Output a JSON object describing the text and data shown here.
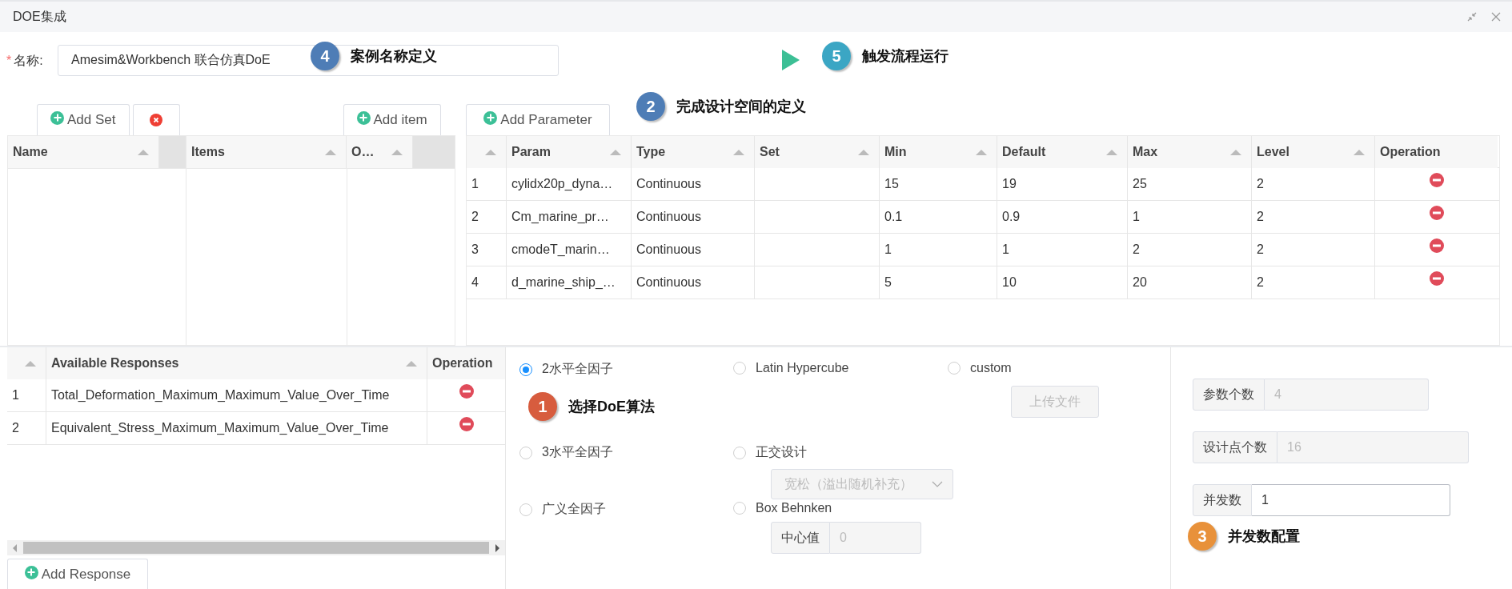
{
  "window": {
    "title": "DOE集成"
  },
  "name_field": {
    "label": "名称:",
    "required_mark": "*",
    "value": "Amesim&Workbench 联合仿真DoE"
  },
  "callouts": [
    {
      "number": "4",
      "text": "案例名称定义",
      "color": "#4e7db6"
    },
    {
      "number": "5",
      "text": "触发流程运行",
      "color": "#3ba6c4"
    },
    {
      "number": "2",
      "text": "完成设计空间的定义",
      "color": "#4e7db6"
    },
    {
      "number": "1",
      "text": "选择DoE算法",
      "color": "#d75c3e"
    },
    {
      "number": "3",
      "text": "并发数配置",
      "color": "#e8913a"
    }
  ],
  "sets_toolbar": {
    "add_set": "Add Set",
    "add_item": "Add item"
  },
  "sets_table": {
    "columns": [
      "Name"
    ]
  },
  "items_table": {
    "columns": [
      "Items",
      "O…"
    ]
  },
  "params_toolbar": {
    "add_parameter": "Add Parameter"
  },
  "params_table": {
    "columns": [
      "Param",
      "Type",
      "Set",
      "Min",
      "Default",
      "Max",
      "Level",
      "Operation"
    ],
    "rows": [
      {
        "index": "1",
        "param": "cylidx20p_dyna…",
        "type": "Continuous",
        "min": "15",
        "default": "19",
        "max": "25",
        "level": "2"
      },
      {
        "index": "2",
        "param": "Cm_marine_pr…",
        "type": "Continuous",
        "min": "0.1",
        "default": "0.9",
        "max": "1",
        "level": "2"
      },
      {
        "index": "3",
        "param": "cmodeT_marin…",
        "type": "Continuous",
        "min": "1",
        "default": "1",
        "max": "2",
        "level": "2"
      },
      {
        "index": "4",
        "param": "d_marine_ship_…",
        "type": "Continuous",
        "min": "5",
        "default": "10",
        "max": "20",
        "level": "2"
      }
    ]
  },
  "responses_table": {
    "columns": [
      "Available Responses",
      "Operation"
    ],
    "rows": [
      {
        "index": "1",
        "name": "Total_Deformation_Maximum_Maximum_Value_Over_Time"
      },
      {
        "index": "2",
        "name": "Equivalent_Stress_Maximum_Maximum_Value_Over_Time"
      }
    ],
    "add_response": "Add Response"
  },
  "algorithm_rows": [
    [
      {
        "label": "2水平全因子",
        "selected": true
      },
      {
        "label": "Latin Hypercube",
        "selected": false
      },
      {
        "label": "custom",
        "selected": false,
        "extra": {
          "kind": "button",
          "label": "上传文件",
          "disabled": true
        }
      }
    ],
    [
      {
        "label": "3水平全因子",
        "selected": false
      },
      {
        "label": "正交设计",
        "selected": false,
        "extra": {
          "kind": "select",
          "value": "宽松（溢出随机补充）",
          "disabled": true
        }
      }
    ],
    [
      {
        "label": "广义全因子",
        "selected": false
      },
      {
        "label": "Box Behnken",
        "selected": false,
        "extra": {
          "kind": "field",
          "label": "中心值",
          "placeholder": "0",
          "disabled": true
        }
      }
    ]
  ],
  "stats": [
    {
      "label": "参数个数",
      "value": "4",
      "disabled": true
    },
    {
      "label": "设计点个数",
      "value": "16",
      "disabled": true
    },
    {
      "label": "并发数",
      "value": "1",
      "disabled": false
    }
  ]
}
